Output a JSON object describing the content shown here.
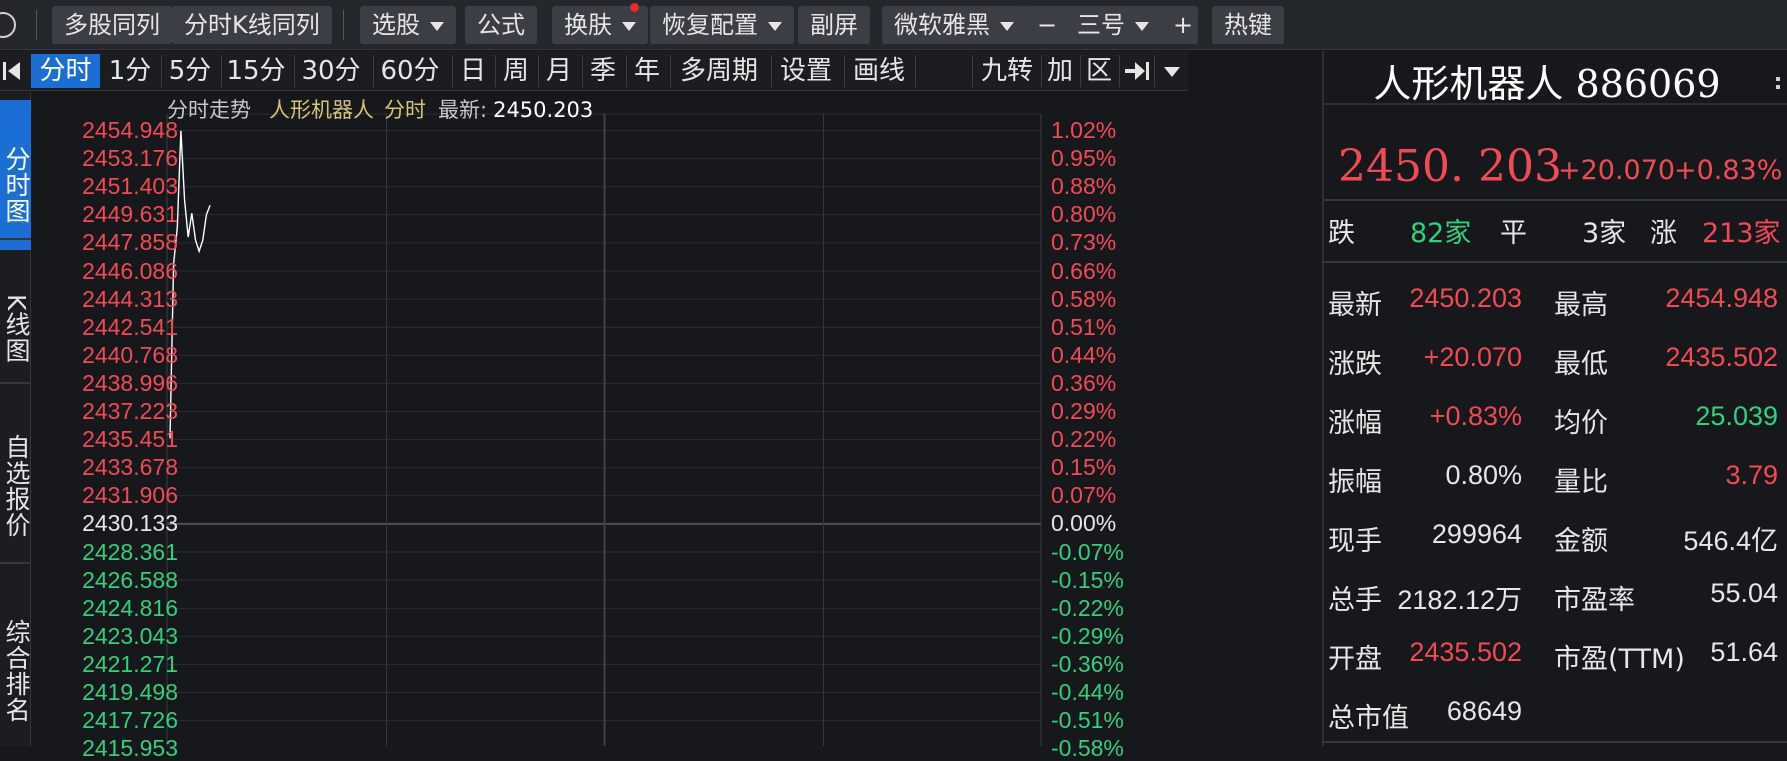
{
  "toolbar": {
    "buttons": [
      {
        "label": "多股同列"
      },
      {
        "label": "分时K线同列"
      },
      {
        "label": "选股"
      },
      {
        "label": "公式"
      },
      {
        "label": "换肤"
      },
      {
        "label": "恢复配置"
      },
      {
        "label": "副屏"
      },
      {
        "label": "微软雅黑"
      },
      {
        "label": "三号"
      },
      {
        "label": "热键"
      }
    ],
    "font_decrease": "−",
    "font_increase": "+"
  },
  "period_tabs": [
    "分时",
    "1分",
    "5分",
    "15分",
    "30分",
    "60分",
    "日",
    "周",
    "月",
    "季",
    "年",
    "多周期",
    "设置",
    "画线"
  ],
  "period_tools": [
    "九转",
    "加",
    "区"
  ],
  "left_tabs": [
    "分时图",
    "K线图",
    "自选报价",
    "综合排名"
  ],
  "chart": {
    "title": "分时走势",
    "name": "人形机器人",
    "period": "分时",
    "latest_label": "最新:",
    "latest_value": "2450.203",
    "colors": {
      "up": "#f24a55",
      "down": "#2fd17a",
      "line": "#ffffff",
      "grid": "#2a2d33"
    }
  },
  "chart_data": {
    "type": "line",
    "title": "分时走势",
    "prev_close": 2430.133,
    "y_ticks": [
      "2454.948",
      "2453.176",
      "2451.403",
      "2449.631",
      "2447.858",
      "2446.086",
      "2444.313",
      "2442.541",
      "2440.768",
      "2438.996",
      "2437.223",
      "2435.451",
      "2433.678",
      "2431.906",
      "2430.133",
      "2428.361",
      "2426.588",
      "2424.816",
      "2423.043",
      "2421.271",
      "2419.498",
      "2417.726",
      "2415.953"
    ],
    "pct_ticks": [
      "1.02%",
      "0.95%",
      "0.88%",
      "0.80%",
      "0.73%",
      "0.66%",
      "0.58%",
      "0.51%",
      "0.44%",
      "0.36%",
      "0.29%",
      "0.22%",
      "0.15%",
      "0.07%",
      "0.00%",
      "-0.07%",
      "-0.15%",
      "-0.22%",
      "-0.29%",
      "-0.36%",
      "-0.44%",
      "-0.51%",
      "-0.58%"
    ],
    "ylim": [
      2415.953,
      2454.948
    ],
    "x_minutes_total": 240,
    "x": [
      0,
      1,
      2,
      3,
      4,
      5,
      6,
      7,
      8,
      9,
      10,
      11
    ],
    "series": [
      {
        "values": [
          2435.5,
          2446.5,
          2448.8,
          2454.9,
          2450.5,
          2448.2,
          2449.7,
          2448.0,
          2447.3,
          2448.0,
          2449.6,
          2450.2
        ]
      }
    ]
  },
  "panel": {
    "name": "人形机器人",
    "code": "886069",
    "price": "2450. 203",
    "change": "+20.070",
    "change_pct": "+0.83%",
    "breadth": {
      "down_label": "跌",
      "down_count": "82家",
      "flat_label": "平",
      "flat_count": "3家",
      "up_label": "涨",
      "up_count": "213家"
    },
    "quote_rows": [
      {
        "l1": "最新",
        "v1": "2450.203",
        "c1": "up",
        "l2": "最高",
        "v2": "2454.948",
        "c2": "up"
      },
      {
        "l1": "涨跌",
        "v1": "+20.070",
        "c1": "up",
        "l2": "最低",
        "v2": "2435.502",
        "c2": "up"
      },
      {
        "l1": "涨幅",
        "v1": "+0.83%",
        "c1": "up",
        "l2": "均价",
        "v2": "25.039",
        "c2": "down"
      },
      {
        "l1": "振幅",
        "v1": "0.80%",
        "c1": "w",
        "l2": "量比",
        "v2": "3.79",
        "c2": "up"
      },
      {
        "l1": "现手",
        "v1": "299964",
        "c1": "w",
        "l2": "金额",
        "v2": "546.4亿",
        "c2": "w"
      },
      {
        "l1": "总手",
        "v1": "2182.12万",
        "c1": "w",
        "l2": "市盈率",
        "v2": "55.04",
        "c2": "w"
      },
      {
        "l1": "开盘",
        "v1": "2435.502",
        "c1": "up",
        "l2": "市盈(TTM)",
        "v2": "51.64",
        "c2": "w"
      },
      {
        "l1": "总市值",
        "v1": "68649",
        "c1": "w",
        "l2": "",
        "v2": "",
        "c2": "w"
      }
    ]
  }
}
